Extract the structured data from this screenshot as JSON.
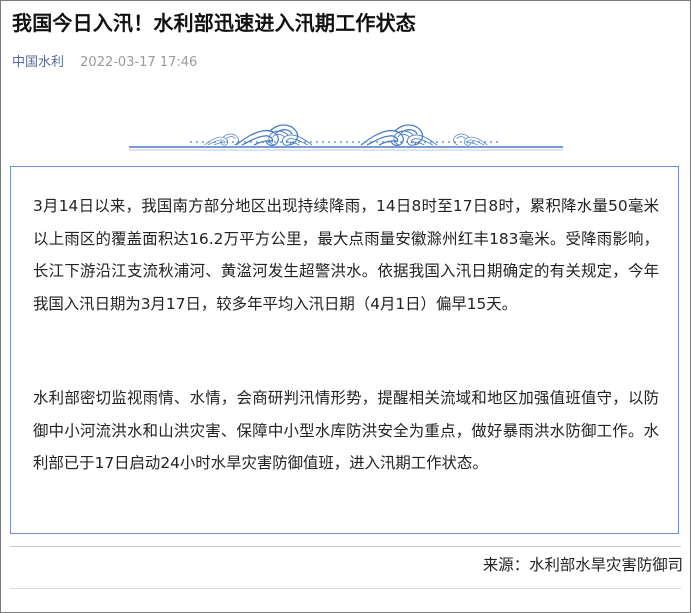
{
  "article": {
    "title": "我国今日入汛！水利部迅速进入汛期工作状态",
    "source_name": "中国水利",
    "date": "2022-03-17 17:46",
    "paragraphs": [
      "3月14日以来，我国南方部分地区出现持续降雨，14日8时至17日8时，累积降水量50毫米以上雨区的覆盖面积达16.2万平方公里，最大点雨量安徽滁州红丰183毫米。受降雨影响，长江下游沿江支流秋浦河、黄湓河发生超警洪水。依据我国入汛日期确定的有关规定，今年我国入汛日期为3月17日，较多年平均入汛日期（4月1日）偏早15天。",
      "水利部密切监视雨情、水情，会商研判汛情形势，提醒相关流域和地区加强值班值守，以防御中小河流洪水和山洪灾害、保障中小型水库防洪安全为重点，做好暴雨洪水防御工作。水利部已于17日启动24小时水旱灾害防御值班，进入汛期工作状态。"
    ],
    "footer_source": "来源：水利部水旱灾害防御司"
  },
  "colors": {
    "source_link": "#576b95",
    "box_border": "#6f8fc6",
    "wave_blue": "#4a7cc4"
  },
  "decoration": {
    "banner_icon": "wave-pattern-icon"
  }
}
